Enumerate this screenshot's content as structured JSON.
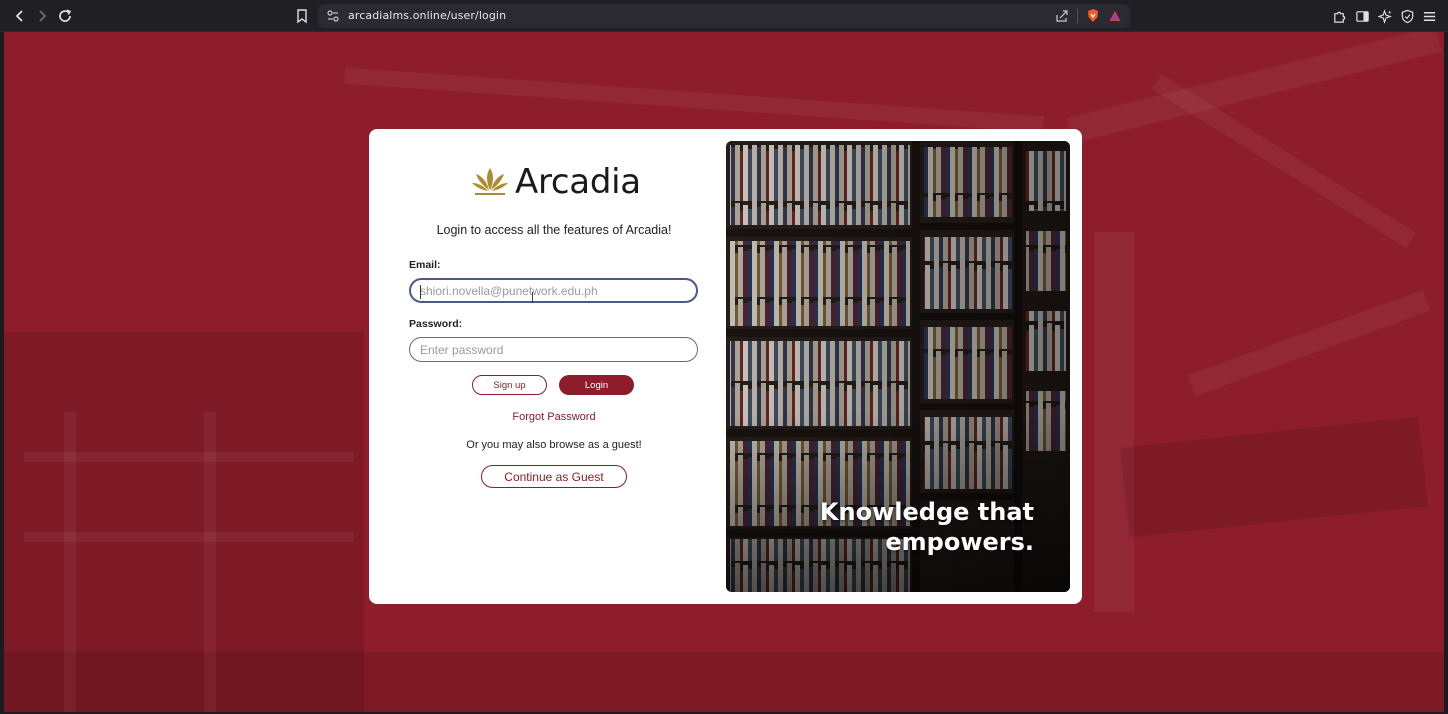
{
  "browser": {
    "url": "arcadialms.online/user/login"
  },
  "login": {
    "logo_text": "Arcadia",
    "subtitle": "Login to access all the features of Arcadia!",
    "email_label": "Email:",
    "email_placeholder": "shiori.novella@punetwork.edu.ph",
    "password_label": "Password:",
    "password_placeholder": "Enter password",
    "signup_label": "Sign up",
    "login_label": "Login",
    "forgot_label": "Forgot Password",
    "guest_prompt": "Or you may also browse as a guest!",
    "guest_label": "Continue as Guest"
  },
  "hero": {
    "line1": "Knowledge that",
    "line2": "empowers."
  },
  "colors": {
    "brand": "#8d1d2b",
    "logo_gold": "#b08a2e"
  }
}
